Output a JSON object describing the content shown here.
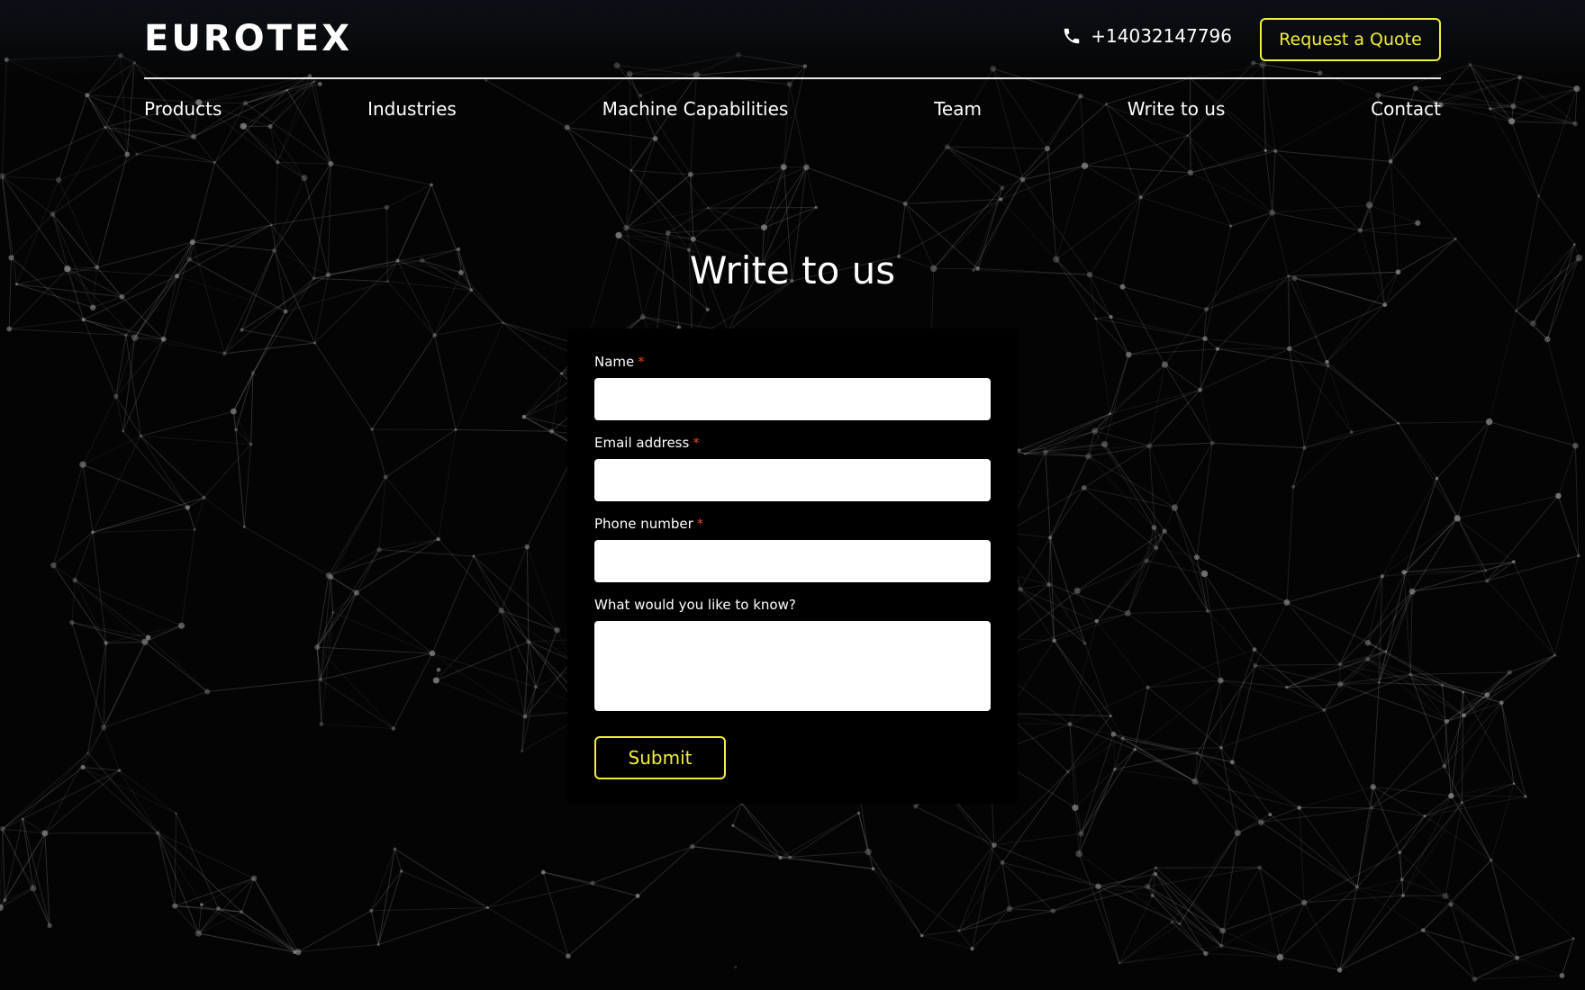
{
  "brand": {
    "logo": "EUROTEX",
    "accent": "#f2ef3a"
  },
  "header": {
    "phone_icon": "phone-icon",
    "phone": "+14032147796",
    "quote_button": "Request a Quote"
  },
  "nav": {
    "items": [
      {
        "label": "Products"
      },
      {
        "label": "Industries"
      },
      {
        "label": "Machine Capabilities"
      },
      {
        "label": "Team"
      },
      {
        "label": "Write to us"
      },
      {
        "label": "Contact"
      }
    ]
  },
  "contact_form": {
    "title": "Write to us",
    "required_marker": "*",
    "fields": {
      "name": {
        "label": "Name",
        "value": ""
      },
      "email": {
        "label": "Email address",
        "value": ""
      },
      "phone": {
        "label": "Phone number",
        "value": ""
      },
      "message": {
        "label": "What would you like to know?",
        "value": ""
      }
    },
    "submit_label": "Submit"
  },
  "colors": {
    "background": "#040404",
    "required": "#e0442e",
    "text": "#ffffff"
  }
}
